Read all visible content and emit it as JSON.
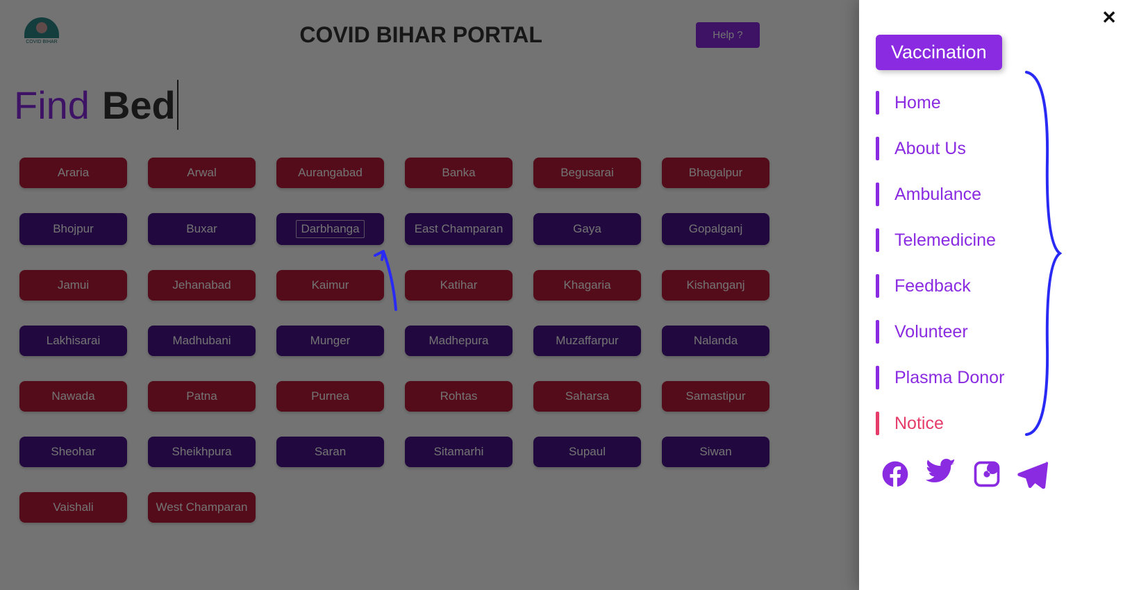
{
  "header": {
    "site_title": "COVID BIHAR PORTAL",
    "help_label": "Help ?",
    "logo_text": "COVID BIHAR"
  },
  "heading": {
    "static_text": "Find",
    "typed_text": "Bed"
  },
  "districts": [
    {
      "name": "Araria",
      "variant": "red"
    },
    {
      "name": "Arwal",
      "variant": "red"
    },
    {
      "name": "Aurangabad",
      "variant": "red"
    },
    {
      "name": "Banka",
      "variant": "red"
    },
    {
      "name": "Begusarai",
      "variant": "red"
    },
    {
      "name": "Bhagalpur",
      "variant": "red"
    },
    {
      "name": "Bhojpur",
      "variant": "purple"
    },
    {
      "name": "Buxar",
      "variant": "purple"
    },
    {
      "name": "Darbhanga",
      "variant": "purple",
      "focused": true
    },
    {
      "name": "East Champaran",
      "variant": "purple"
    },
    {
      "name": "Gaya",
      "variant": "purple"
    },
    {
      "name": "Gopalganj",
      "variant": "purple"
    },
    {
      "name": "Jamui",
      "variant": "red"
    },
    {
      "name": "Jehanabad",
      "variant": "red"
    },
    {
      "name": "Kaimur",
      "variant": "red"
    },
    {
      "name": "Katihar",
      "variant": "red"
    },
    {
      "name": "Khagaria",
      "variant": "red"
    },
    {
      "name": "Kishanganj",
      "variant": "red"
    },
    {
      "name": "Lakhisarai",
      "variant": "purple"
    },
    {
      "name": "Madhubani",
      "variant": "purple"
    },
    {
      "name": "Munger",
      "variant": "purple"
    },
    {
      "name": "Madhepura",
      "variant": "purple"
    },
    {
      "name": "Muzaffarpur",
      "variant": "purple"
    },
    {
      "name": "Nalanda",
      "variant": "purple"
    },
    {
      "name": "Nawada",
      "variant": "red"
    },
    {
      "name": "Patna",
      "variant": "red"
    },
    {
      "name": "Purnea",
      "variant": "red"
    },
    {
      "name": "Rohtas",
      "variant": "red"
    },
    {
      "name": "Saharsa",
      "variant": "red"
    },
    {
      "name": "Samastipur",
      "variant": "red"
    },
    {
      "name": "Sheohar",
      "variant": "purple"
    },
    {
      "name": "Sheikhpura",
      "variant": "purple"
    },
    {
      "name": "Saran",
      "variant": "purple"
    },
    {
      "name": "Sitamarhi",
      "variant": "purple"
    },
    {
      "name": "Supaul",
      "variant": "purple"
    },
    {
      "name": "Siwan",
      "variant": "purple"
    },
    {
      "name": "Vaishali",
      "variant": "red"
    },
    {
      "name": "West Champaran",
      "variant": "red"
    }
  ],
  "side_panel": {
    "vaccination_label": "Vaccination",
    "nav": [
      {
        "label": "Home",
        "variant": "normal"
      },
      {
        "label": "About Us",
        "variant": "normal"
      },
      {
        "label": "Ambulance",
        "variant": "normal"
      },
      {
        "label": "Telemedicine",
        "variant": "normal"
      },
      {
        "label": "Feedback",
        "variant": "normal"
      },
      {
        "label": "Volunteer",
        "variant": "normal"
      },
      {
        "label": "Plasma Donor",
        "variant": "normal"
      },
      {
        "label": "Notice",
        "variant": "notice"
      }
    ],
    "social": [
      {
        "name": "facebook-icon"
      },
      {
        "name": "twitter-icon"
      },
      {
        "name": "instagram-icon"
      },
      {
        "name": "telegram-icon"
      }
    ]
  },
  "colors": {
    "accent": "#8a2be2",
    "red_district": "#bc1c3a",
    "purple_district": "#4a148c",
    "notice": "#e53c6a",
    "annotation": "#2a2af5"
  }
}
